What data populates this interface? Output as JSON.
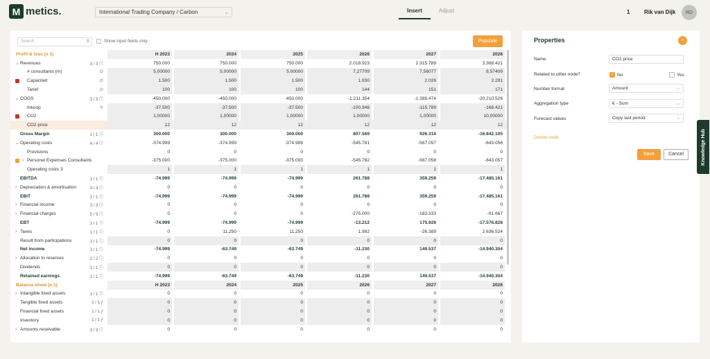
{
  "app": {
    "logo_letter": "M",
    "logo_text": "metics."
  },
  "header": {
    "company": "International Trading Company / Carbon",
    "tabs": [
      "Insert",
      "Adjust"
    ],
    "notifications": "1",
    "user": "Rik van Dijk",
    "avatar": "RD"
  },
  "toolbar": {
    "search_placeholder": "Search",
    "show_inputs": "Show input fields only",
    "populate": "Populate"
  },
  "columns": [
    "H 2023",
    "2024",
    "2025",
    "2026",
    "2027",
    "2028"
  ],
  "rows": [
    {
      "type": "section",
      "label": "Profit & loss (x 1)",
      "cells": [
        "H 2023",
        "2024",
        "2025",
        "2026",
        "2027",
        "2028"
      ]
    },
    {
      "label": "Revenues",
      "chev": "v",
      "indent": 0,
      "count": "3 / 3",
      "cells": [
        "750.000",
        "750.000",
        "750.000",
        "2.018.923",
        "2.315.789",
        "3.368.421"
      ]
    },
    {
      "label": "# consultants (m)",
      "indent": 1,
      "icon": "∅",
      "inp": true,
      "cells": [
        "5,00000",
        "5,00000",
        "5,00000",
        "7,27709",
        "7,56077",
        "8,57409"
      ]
    },
    {
      "label": "Capaciteit",
      "indent": 1,
      "red": true,
      "icon": "∅",
      "inp": true,
      "cells": [
        "1.500",
        "1.500",
        "1.500",
        "1.930",
        "2.026",
        "2.291"
      ]
    },
    {
      "label": "Tarief",
      "indent": 1,
      "icon": "∅",
      "inp": true,
      "cells": [
        "100",
        "100",
        "100",
        "144",
        "151",
        "171"
      ]
    },
    {
      "label": "COGS",
      "chev": "v",
      "indent": 0,
      "count": "3 / 3",
      "cells": [
        "-450.000",
        "-450.000",
        "-450.000",
        "-1.211.354",
        "-1.389.474",
        "-20.210.526"
      ]
    },
    {
      "label": "Inkoop",
      "indent": 1,
      "icon": "✎",
      "inp": true,
      "cells": [
        "-37.500",
        "-37.500",
        "-37.500",
        "-100.946",
        "-115.789",
        "-168.421"
      ]
    },
    {
      "label": "CO2",
      "indent": 1,
      "red": true,
      "inp": true,
      "cells": [
        "1,00000",
        "1,00000",
        "1,00000",
        "1,00000",
        "1,00000",
        "10,00000"
      ]
    },
    {
      "label": "CO2 price",
      "indent": 1,
      "hl": true,
      "inp": true,
      "cells": [
        "12",
        "12",
        "12",
        "12",
        "12",
        "12"
      ]
    },
    {
      "label": "Gross Margin",
      "bold": true,
      "indent": 0,
      "count": "1 / 1",
      "cells": [
        "300.000",
        "300.000",
        "300.000",
        "807.569",
        "926.316",
        "-16.842.105"
      ]
    },
    {
      "label": "Operating costs",
      "chev": "v",
      "indent": 0,
      "count": "4 / 4",
      "cells": [
        "-374.999",
        "-374.999",
        "-374.999",
        "-545.781",
        "-567.057",
        "-643.056"
      ]
    },
    {
      "label": "Provisions",
      "indent": 1,
      "cells": [
        "0",
        "0",
        "0",
        "0",
        "0",
        "0"
      ]
    },
    {
      "label": "Personel Expenses Consultants",
      "chev": ">",
      "indent": 1,
      "orange": true,
      "cells": [
        "-375.000",
        "-375.000",
        "-375.000",
        "-545.782",
        "-567.058",
        "-643.057"
      ]
    },
    {
      "label": "Operating costs 3",
      "indent": 1,
      "inp": true,
      "cells": [
        "1",
        "1",
        "1",
        "1",
        "1",
        "1"
      ]
    },
    {
      "label": "EBITDA",
      "bold": true,
      "indent": 0,
      "count": "1 / 1",
      "cells": [
        "-74.999",
        "-74.999",
        "-74.999",
        "261.788",
        "359.259",
        "-17.485.161"
      ]
    },
    {
      "label": "Depreciation & amortisation",
      "chev": ">",
      "indent": 0,
      "count": "3 / 3",
      "cells": [
        "0",
        "0",
        "0",
        "0",
        "0",
        "0"
      ]
    },
    {
      "label": "EBIT",
      "bold": true,
      "indent": 0,
      "count": "1 / 1",
      "cells": [
        "-74.999",
        "-74.999",
        "-74.999",
        "261.788",
        "359.259",
        "-17.485.161"
      ]
    },
    {
      "label": "Financial income",
      "chev": ">",
      "indent": 0,
      "count": "3 / 3",
      "cells": [
        "0",
        "0",
        "0",
        "0",
        "0",
        "0"
      ]
    },
    {
      "label": "Financial charges",
      "chev": ">",
      "indent": 0,
      "count": "5 / 5",
      "cells": [
        "0",
        "0",
        "0",
        "-275.000",
        "-183.333",
        "-91.667"
      ]
    },
    {
      "label": "EBT",
      "bold": true,
      "indent": 0,
      "count": "1 / 1",
      "cells": [
        "-74.999",
        "-74.999",
        "-74.999",
        "-13.212",
        "175.926",
        "-17.576.828"
      ]
    },
    {
      "label": "Taxes",
      "chev": ">",
      "indent": 0,
      "count": "1 / 1",
      "cells": [
        "0",
        "11.250",
        "11.250",
        "1.982",
        "-26.389",
        "2.636.524"
      ]
    },
    {
      "label": "Result from participations",
      "indent": 0,
      "count": "1 / 1",
      "inp": true,
      "cells": [
        "0",
        "0",
        "0",
        "0",
        "0",
        "0"
      ]
    },
    {
      "label": "Net income",
      "bold": true,
      "indent": 0,
      "count": "1 / 1",
      "cells": [
        "-74.999",
        "-63.749",
        "-63.749",
        "-11.230",
        "149.537",
        "-14.940.304"
      ]
    },
    {
      "label": "Allocation to reserves",
      "chev": ">",
      "indent": 0,
      "count": "2 / 2",
      "cells": [
        "0",
        "0",
        "0",
        "0",
        "0",
        "0"
      ]
    },
    {
      "label": "Dividends",
      "indent": 0,
      "count": "1 / 1",
      "inp": true,
      "cells": [
        "0",
        "0",
        "0",
        "0",
        "0",
        "0"
      ]
    },
    {
      "label": "Retained earnings",
      "bold": true,
      "indent": 0,
      "count": "1 / 1",
      "cells": [
        "-74.999",
        "-63.749",
        "-63.749",
        "-11.230",
        "149.537",
        "-14.940.304"
      ]
    },
    {
      "type": "section",
      "label": "Balance sheet (x 1)",
      "cells": [
        "H 2023",
        "2024",
        "2025",
        "2026",
        "2027",
        "2028"
      ]
    },
    {
      "label": "Intangible fixed assets",
      "chev": ">",
      "indent": 0,
      "count": "1 / 1",
      "cells": [
        "0",
        "0",
        "0",
        "0",
        "0",
        "0"
      ]
    },
    {
      "label": "Tangible fixed assets",
      "indent": 0,
      "count": "1 / 1",
      "fx": "ƒₓ",
      "inp": true,
      "cells": [
        "0",
        "0",
        "0",
        "0",
        "0",
        "0"
      ]
    },
    {
      "label": "Financial fixed assets",
      "indent": 0,
      "count": "1 / 1",
      "fx": "ƒₓ",
      "inp": true,
      "cells": [
        "0",
        "0",
        "0",
        "0",
        "0",
        "0"
      ]
    },
    {
      "label": "Inventory",
      "indent": 0,
      "count": "1 / 1",
      "fx": "ƒₓ",
      "inp": true,
      "cells": [
        "0",
        "0",
        "0",
        "0",
        "0",
        "0"
      ]
    },
    {
      "label": "Amounts receivable",
      "chev": ">",
      "indent": 0,
      "count": "3 / 3",
      "cells": [
        "0",
        "0",
        "0",
        "0",
        "0",
        "0"
      ]
    }
  ],
  "properties": {
    "title": "Properties",
    "name_label": "Name",
    "name_value": "CO2 price",
    "related_label": "Related to other node?",
    "no": "No",
    "yes": "Yes",
    "number_format_label": "Number format",
    "number_format": "Amount",
    "aggregation_label": "Aggregation type",
    "aggregation": "€ - Sum",
    "forecast_label": "Forecast values",
    "forecast": "Copy last period",
    "delete": "Delete node",
    "save": "Save",
    "cancel": "Cancel"
  },
  "knowledge_hub": "Knowledge Hub"
}
